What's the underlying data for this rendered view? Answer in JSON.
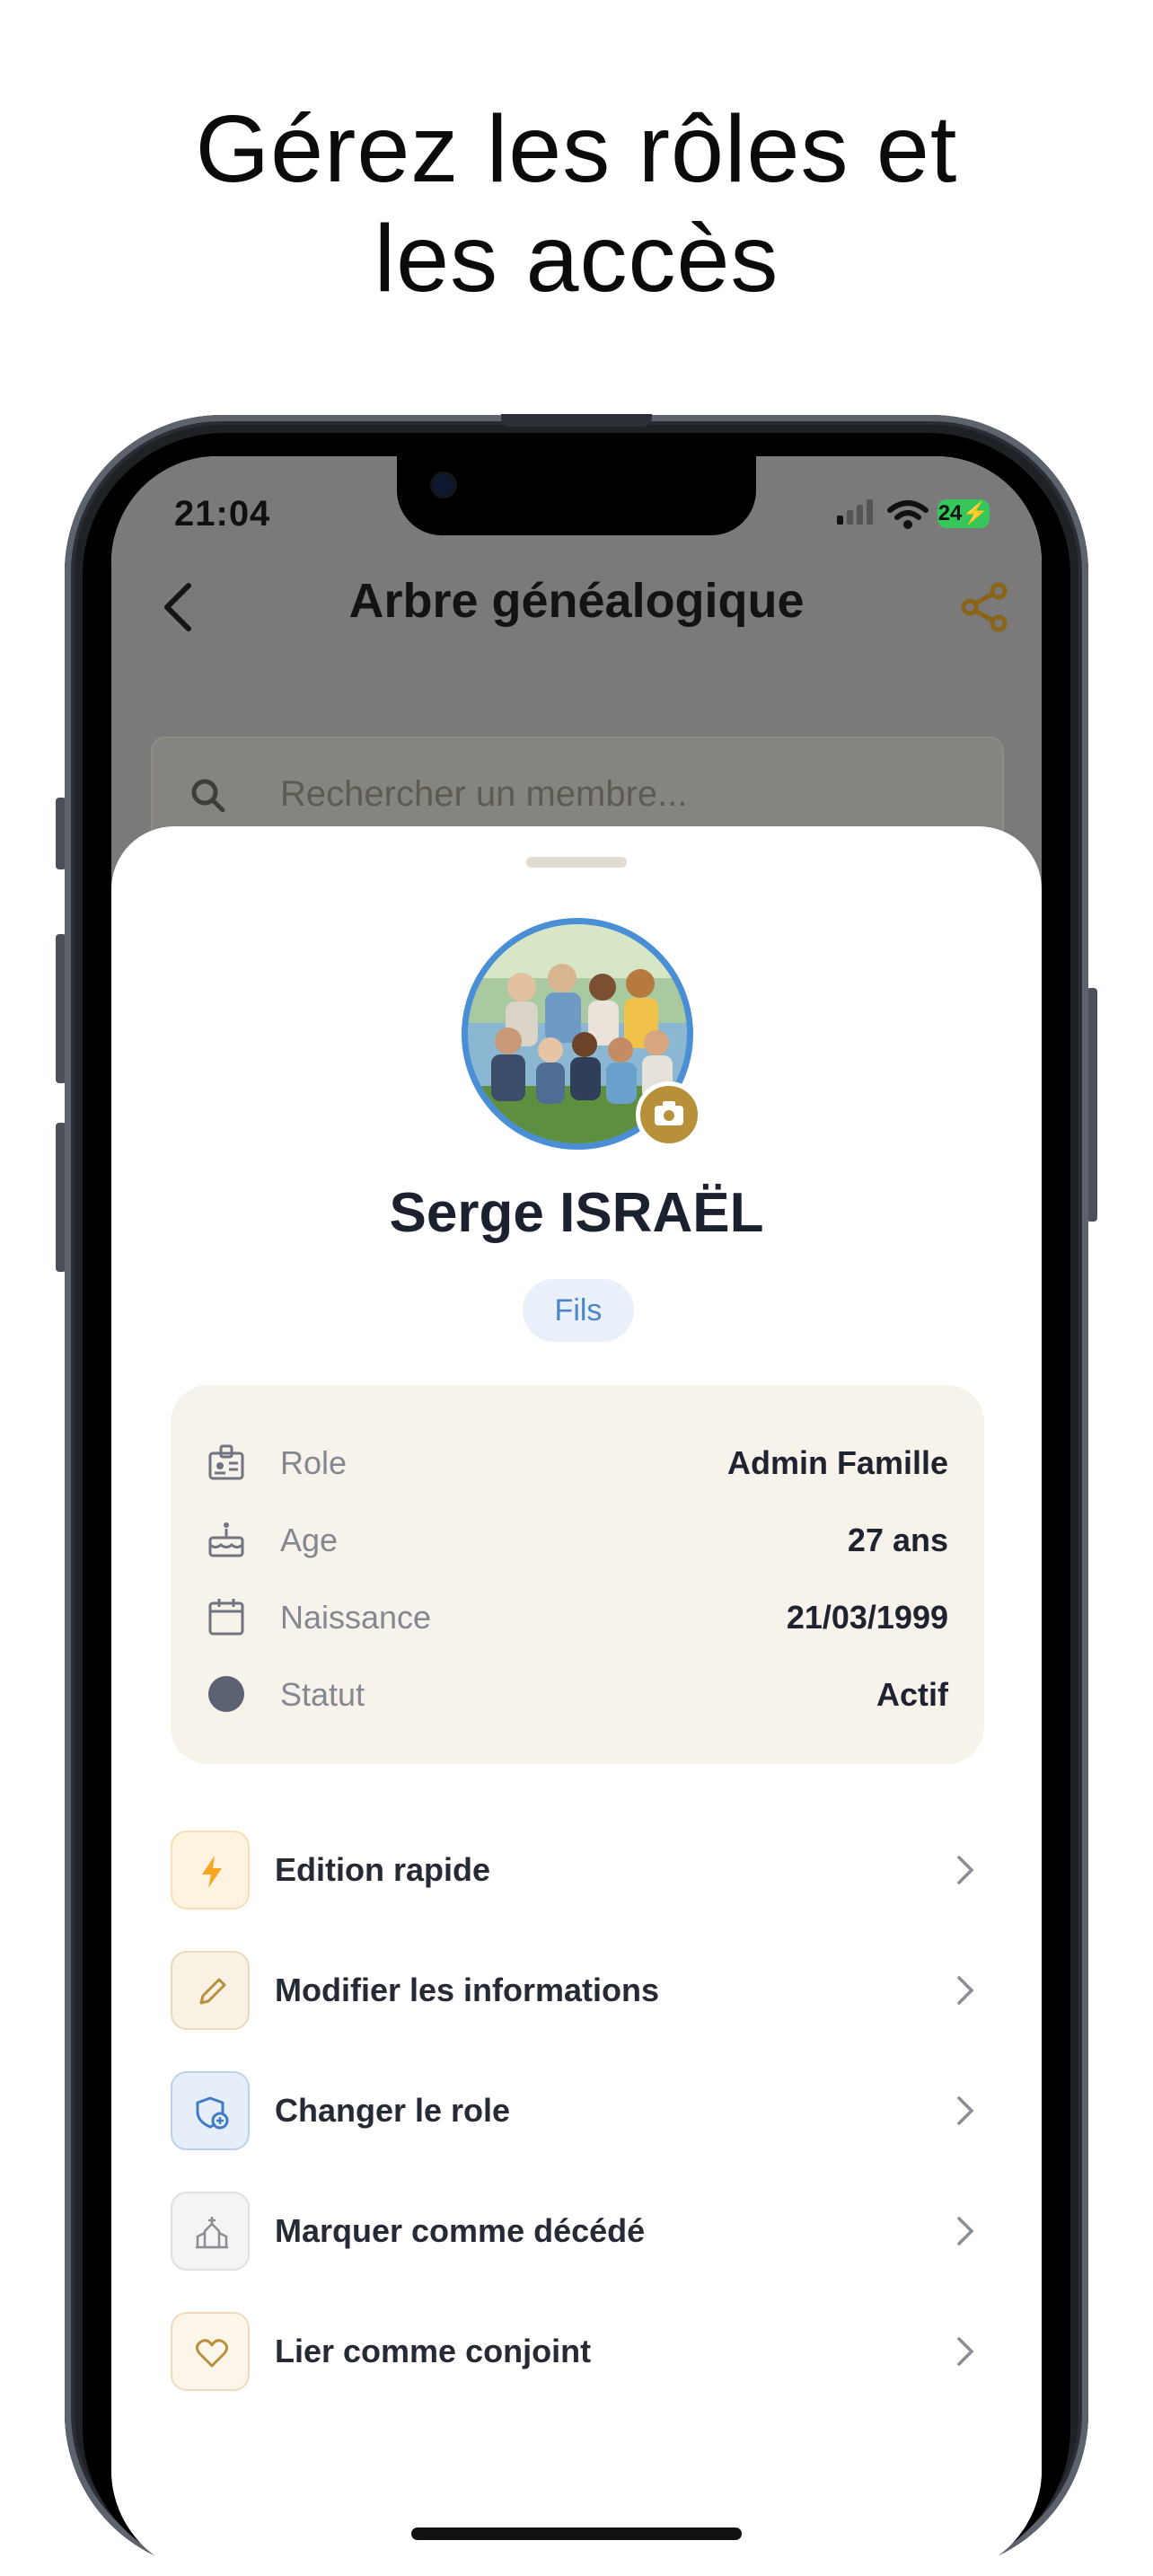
{
  "headline": {
    "line1": "Gérez les rôles et",
    "line2": "les accès"
  },
  "status_bar": {
    "time": "21:04",
    "battery": "24"
  },
  "app_bar": {
    "title": "Arbre généalogique",
    "back_icon": "chevron-left-icon",
    "share_icon": "share-icon"
  },
  "search": {
    "placeholder": "Rechercher un membre..."
  },
  "profile": {
    "name": "Serge ISRAËL",
    "relation": "Fils",
    "avatar_icon": "family-photo",
    "camera_icon": "camera-icon"
  },
  "info": [
    {
      "icon": "id-badge-icon",
      "label": "Role",
      "value": "Admin Famille"
    },
    {
      "icon": "cake-icon",
      "label": "Age",
      "value": "27 ans"
    },
    {
      "icon": "calendar-icon",
      "label": "Naissance",
      "value": "21/03/1999"
    },
    {
      "icon": "status-dot-icon",
      "label": "Statut",
      "value": "Actif"
    }
  ],
  "actions": [
    {
      "icon": "lightning-icon",
      "label": "Edition rapide",
      "color": "#f5a623"
    },
    {
      "icon": "pencil-icon",
      "label": "Modifier les informations",
      "color": "#b8903a"
    },
    {
      "icon": "shield-icon",
      "label": "Changer le role",
      "color": "#3f7cc4"
    },
    {
      "icon": "church-icon",
      "label": "Marquer comme décédé",
      "color": "#8a8d94"
    },
    {
      "icon": "heart-icon",
      "label": "Lier comme conjoint",
      "color": "#b8903a"
    }
  ],
  "colors": {
    "accent": "#b8903a",
    "avatar_ring": "#4a8fd6",
    "card_bg": "#f7f2ea"
  }
}
